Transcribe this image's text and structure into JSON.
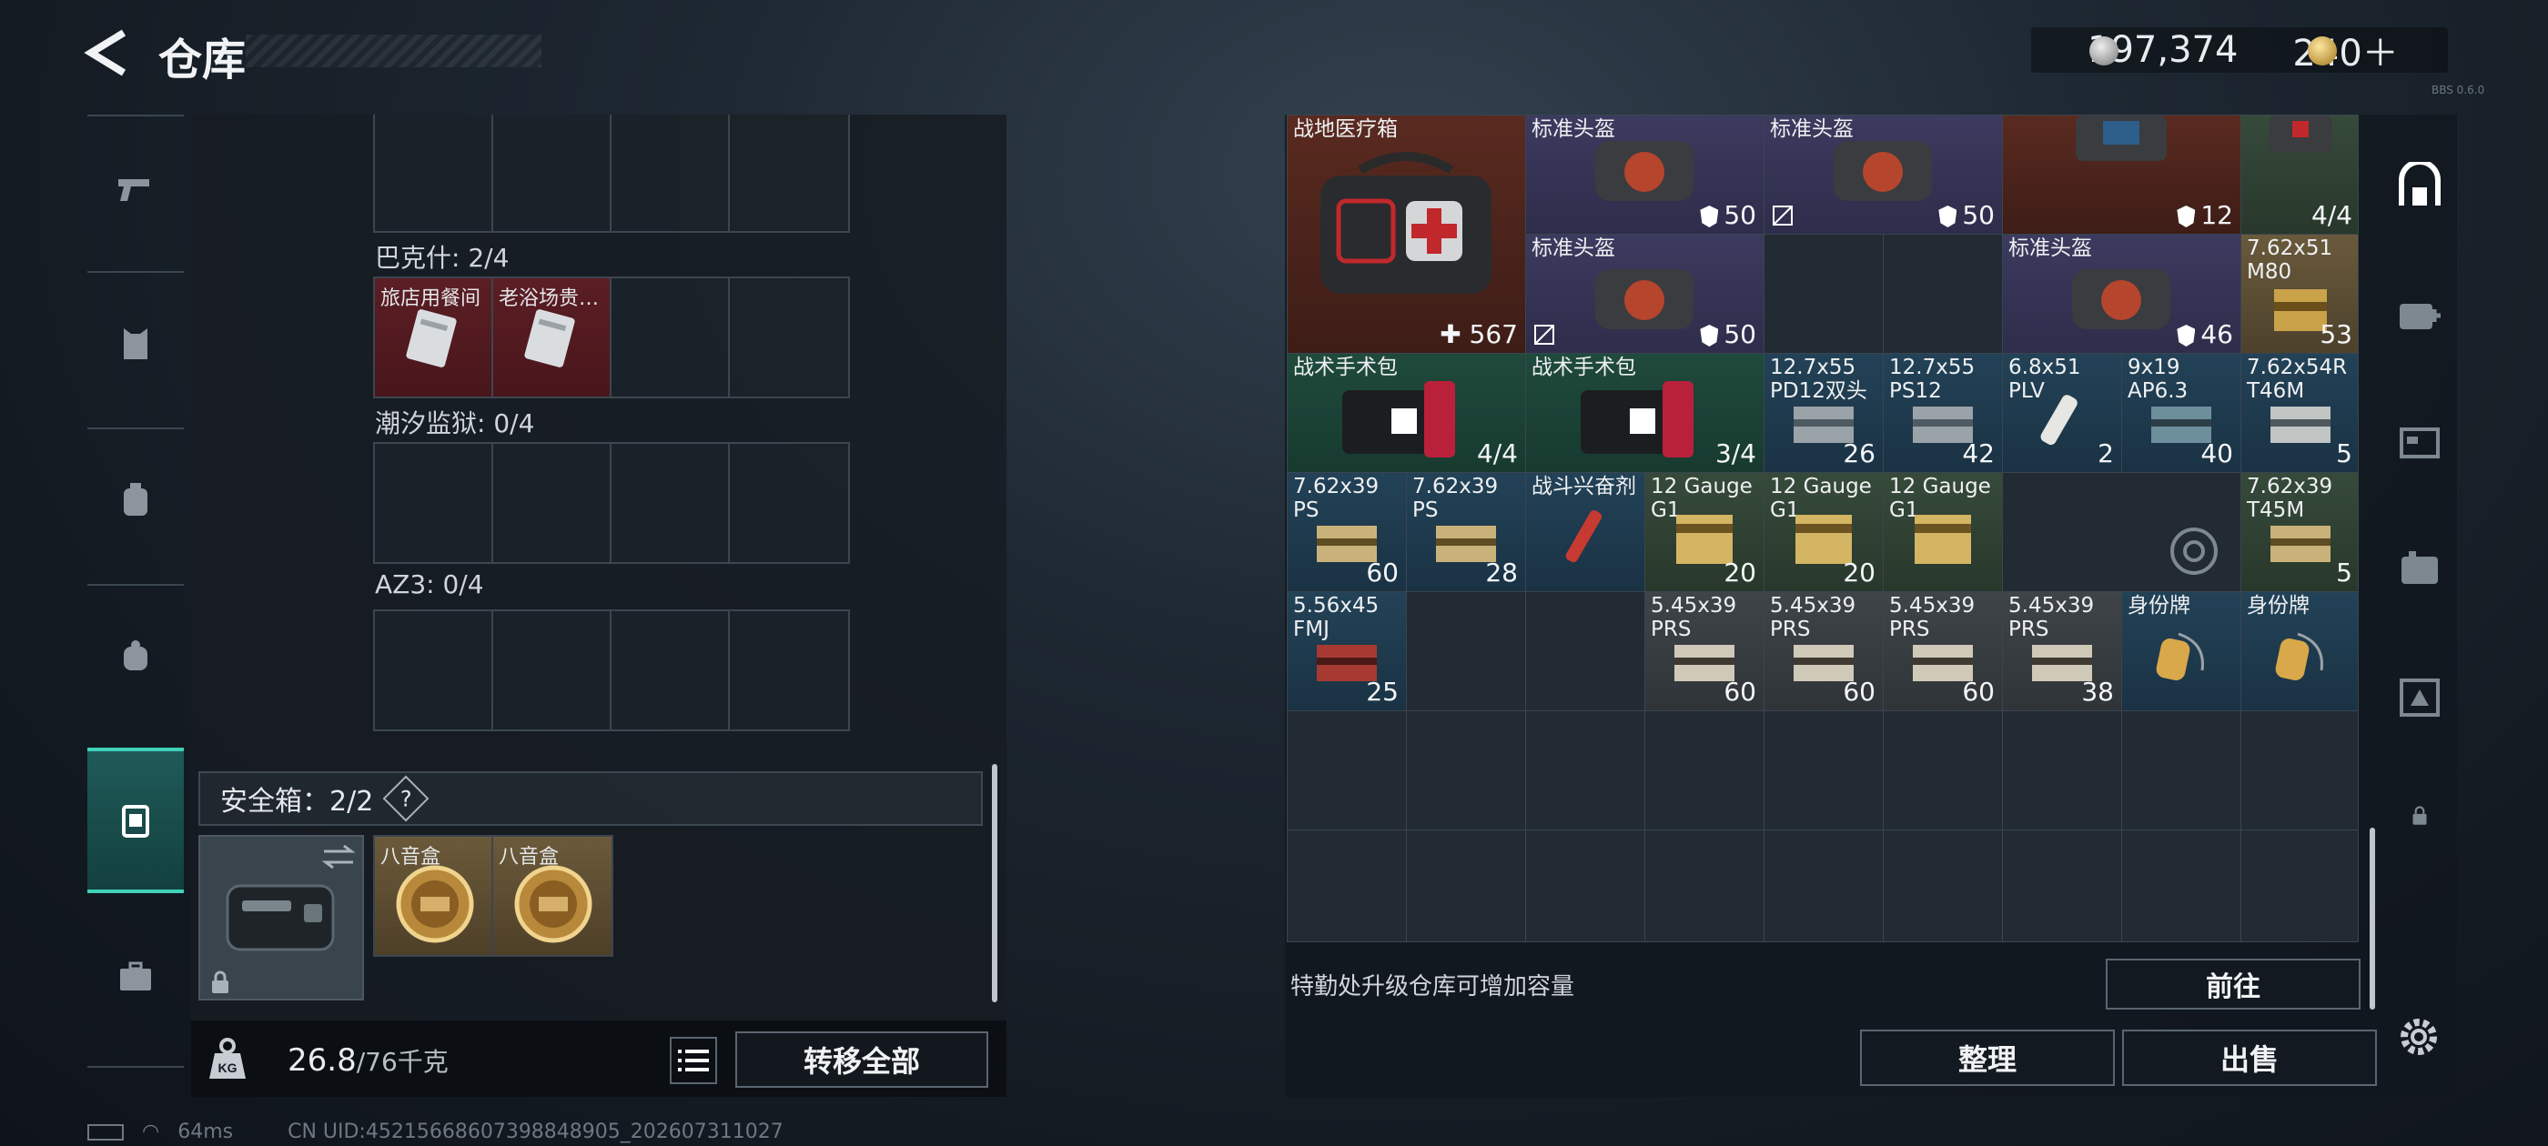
{
  "header": {
    "title": "仓库",
    "currency_silver": "197,374",
    "currency_gold": "240＋",
    "version": "BBS 0.6.0"
  },
  "left_nav": [
    "weapon-icon",
    "armor-icon",
    "backpack-icon",
    "rig-icon",
    "safebox-icon",
    "toolbox-icon"
  ],
  "left_panel": {
    "sections": [
      {
        "label": "巴克什: 2/4",
        "slots": [
          "旅店用餐间",
          "老浴场贵…",
          "",
          ""
        ]
      },
      {
        "label": "潮汐监狱: 0/4",
        "slots": [
          "",
          "",
          "",
          ""
        ]
      },
      {
        "label": "AZ3: 0/4",
        "slots": [
          "",
          "",
          "",
          ""
        ]
      }
    ],
    "safebox": {
      "label": "安全箱：2/2",
      "help": "?",
      "items": [
        "八音盒",
        "八音盒"
      ]
    },
    "weight": {
      "current": "26.8",
      "max": "/76千克"
    },
    "transfer_all": "转移全部"
  },
  "warehouse": {
    "row0": [
      {
        "name": "战地医疗箱",
        "count": "✚ 567"
      },
      {
        "name": "标准头盔",
        "count": "50"
      },
      {
        "name": "标准头盔",
        "count": "50"
      },
      {
        "name": "",
        "count": "12"
      },
      {
        "name": "",
        "count": "4/4"
      }
    ],
    "row1": [
      {
        "name": "标准头盔",
        "count": "50"
      },
      {
        "name": "标准头盔",
        "count": "46"
      },
      {
        "name": "7.62x51 M80",
        "count": "53"
      }
    ],
    "row2": [
      {
        "name": "战术手术包",
        "count": "4/4"
      },
      {
        "name": "战术手术包",
        "count": "3/4"
      },
      {
        "name": "12.7x55 PD12双头",
        "count": "26"
      },
      {
        "name": "12.7x55 PS12",
        "count": "42"
      },
      {
        "name": "6.8x51 PLV",
        "count": "2"
      },
      {
        "name": "9x19 AP6.3",
        "count": "40"
      },
      {
        "name": "7.62x54R T46M",
        "count": "5"
      }
    ],
    "row3": [
      {
        "name": "7.62x39 PS",
        "count": "60"
      },
      {
        "name": "7.62x39 PS",
        "count": "28"
      },
      {
        "name": "战斗兴奋剂",
        "count": ""
      },
      {
        "name": "12 Gauge G1",
        "count": "20"
      },
      {
        "name": "12 Gauge G1",
        "count": "20"
      },
      {
        "name": "12 Gauge G1",
        "count": ""
      },
      {
        "name": "7.62x39 T45M",
        "count": "5"
      }
    ],
    "row4": [
      {
        "name": "5.56x45 FMJ",
        "count": "25"
      },
      {
        "name": "5.45x39 PRS",
        "count": "60"
      },
      {
        "name": "5.45x39 PRS",
        "count": "60"
      },
      {
        "name": "5.45x39 PRS",
        "count": "60"
      },
      {
        "name": "5.45x39 PRS",
        "count": "38"
      },
      {
        "name": "身份牌",
        "count": ""
      },
      {
        "name": "身份牌",
        "count": ""
      }
    ]
  },
  "footer": {
    "upgrade_hint": "特勤处升级仓库可增加容量",
    "goto": "前往",
    "sort": "整理",
    "sell": "出售"
  },
  "status": {
    "ping": "64ms",
    "uid": "CN UID:452156686073988489​05_202607311027"
  },
  "colors": {
    "accent": "#3fd2b8",
    "red_slot": "#5b1e24",
    "gold_slot": "#6b5a3a"
  }
}
